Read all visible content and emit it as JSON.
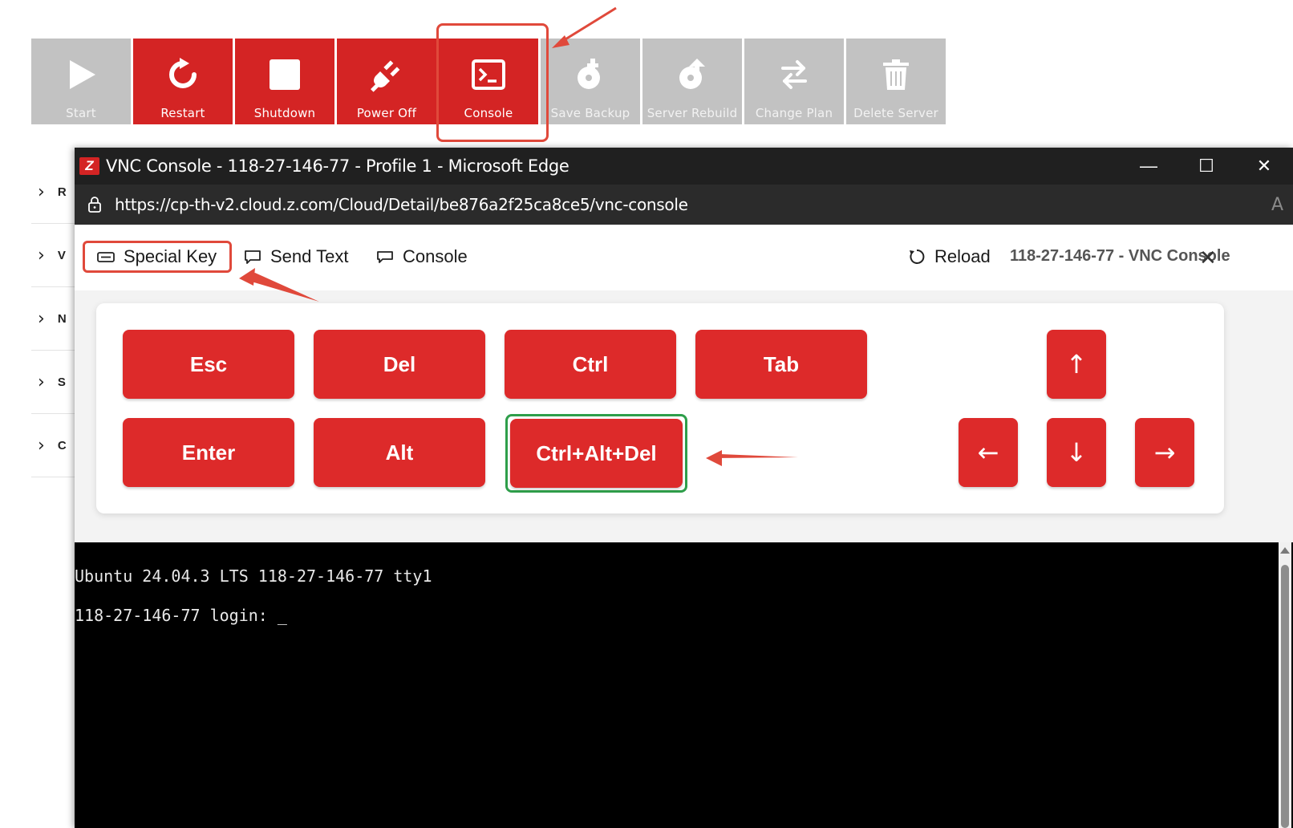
{
  "toolbar": {
    "buttons": [
      {
        "label": "Start",
        "icon": "play-icon",
        "state": "disabled"
      },
      {
        "label": "Restart",
        "icon": "restart-icon",
        "state": "active"
      },
      {
        "label": "Shutdown",
        "icon": "stop-icon",
        "state": "active"
      },
      {
        "label": "Power Off",
        "icon": "plug-icon",
        "state": "active"
      },
      {
        "label": "Console",
        "icon": "terminal-icon",
        "state": "active"
      },
      {
        "label": "Save Backup",
        "icon": "backup-icon",
        "state": "disabled"
      },
      {
        "label": "Server Rebuild",
        "icon": "rebuild-icon",
        "state": "disabled"
      },
      {
        "label": "Change Plan",
        "icon": "swap-arrows-icon",
        "state": "disabled"
      },
      {
        "label": "Delete Server",
        "icon": "trash-icon",
        "state": "disabled"
      }
    ]
  },
  "sidebar": {
    "rows": [
      {
        "letter": "R"
      },
      {
        "letter": "V"
      },
      {
        "letter": "N"
      },
      {
        "letter": "S"
      },
      {
        "letter": "C"
      }
    ]
  },
  "window": {
    "logo_letter": "Z",
    "title": "VNC Console - 118-27-146-77 - Profile 1 - Microsoft Edge",
    "controls": {
      "minimize": "—",
      "maximize": "☐",
      "close": "✕"
    },
    "url": "https://cp-th-v2.cloud.z.com/Cloud/Detail/be876a2f25ca8ce5/vnc-console",
    "read_aloud": "A"
  },
  "nav": {
    "special_key": "Special Key",
    "send_text": "Send Text",
    "console": "Console",
    "reload": "Reload",
    "vnc_title": "118-27-146-77 - VNC Console",
    "close": "✕"
  },
  "keys": {
    "esc": "Esc",
    "del": "Del",
    "ctrl": "Ctrl",
    "tab": "Tab",
    "enter": "Enter",
    "alt": "Alt",
    "ctrl_alt_del": "Ctrl+Alt+Del",
    "up": "↑",
    "left": "←",
    "down": "↓",
    "right": "→"
  },
  "terminal": {
    "line1": "Ubuntu 24.04.3 LTS 118-27-146-77 tty1",
    "line2": "118-27-146-77 login: _"
  },
  "colors": {
    "brand_red": "#d42424",
    "disabled_gray": "#c2c2c2",
    "highlight_red": "#e0493b",
    "highlight_green": "#2e9e4a"
  }
}
